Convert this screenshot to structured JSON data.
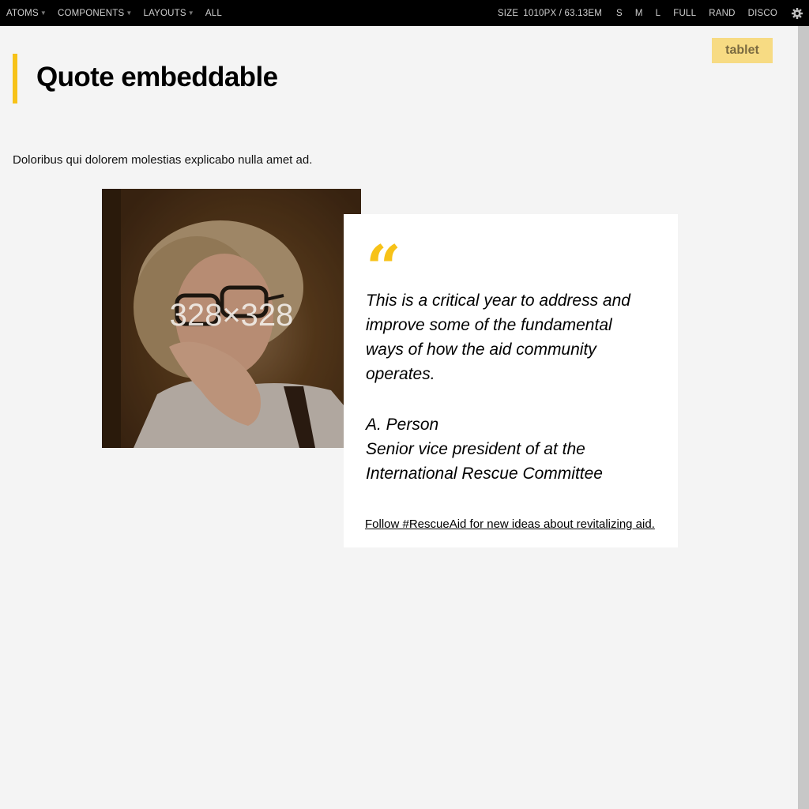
{
  "toolbar": {
    "nav": [
      {
        "label": "ATOMS",
        "has_caret": true
      },
      {
        "label": "COMPONENTS",
        "has_caret": true
      },
      {
        "label": "LAYOUTS",
        "has_caret": true
      },
      {
        "label": "ALL",
        "has_caret": false
      }
    ],
    "size_label": "SIZE",
    "size_value": "1010PX / 63.13EM",
    "sizes": [
      "S",
      "M",
      "L",
      "FULL",
      "RAND",
      "DISCO"
    ],
    "settings_icon": "gear-icon"
  },
  "badge": {
    "label": "tablet",
    "color": "#f7db83"
  },
  "page": {
    "title": "Quote embeddable",
    "description": "Doloribus qui dolorem molestias explicabo nulla amet ad."
  },
  "image": {
    "placeholder": "328×328"
  },
  "quote": {
    "mark": "“",
    "text": "This is a critical year to address and improve some of the fundamental ways of how the aid community operates.",
    "author_name": "A. Person",
    "author_title_line1": "Senior vice president of at the",
    "author_title_line2": "International Rescue Committee",
    "link": "Follow #RescueAid for new ideas about revitalizing aid."
  },
  "colors": {
    "accent": "#f7c218",
    "topbar": "#000000",
    "background": "#f4f4f4"
  }
}
